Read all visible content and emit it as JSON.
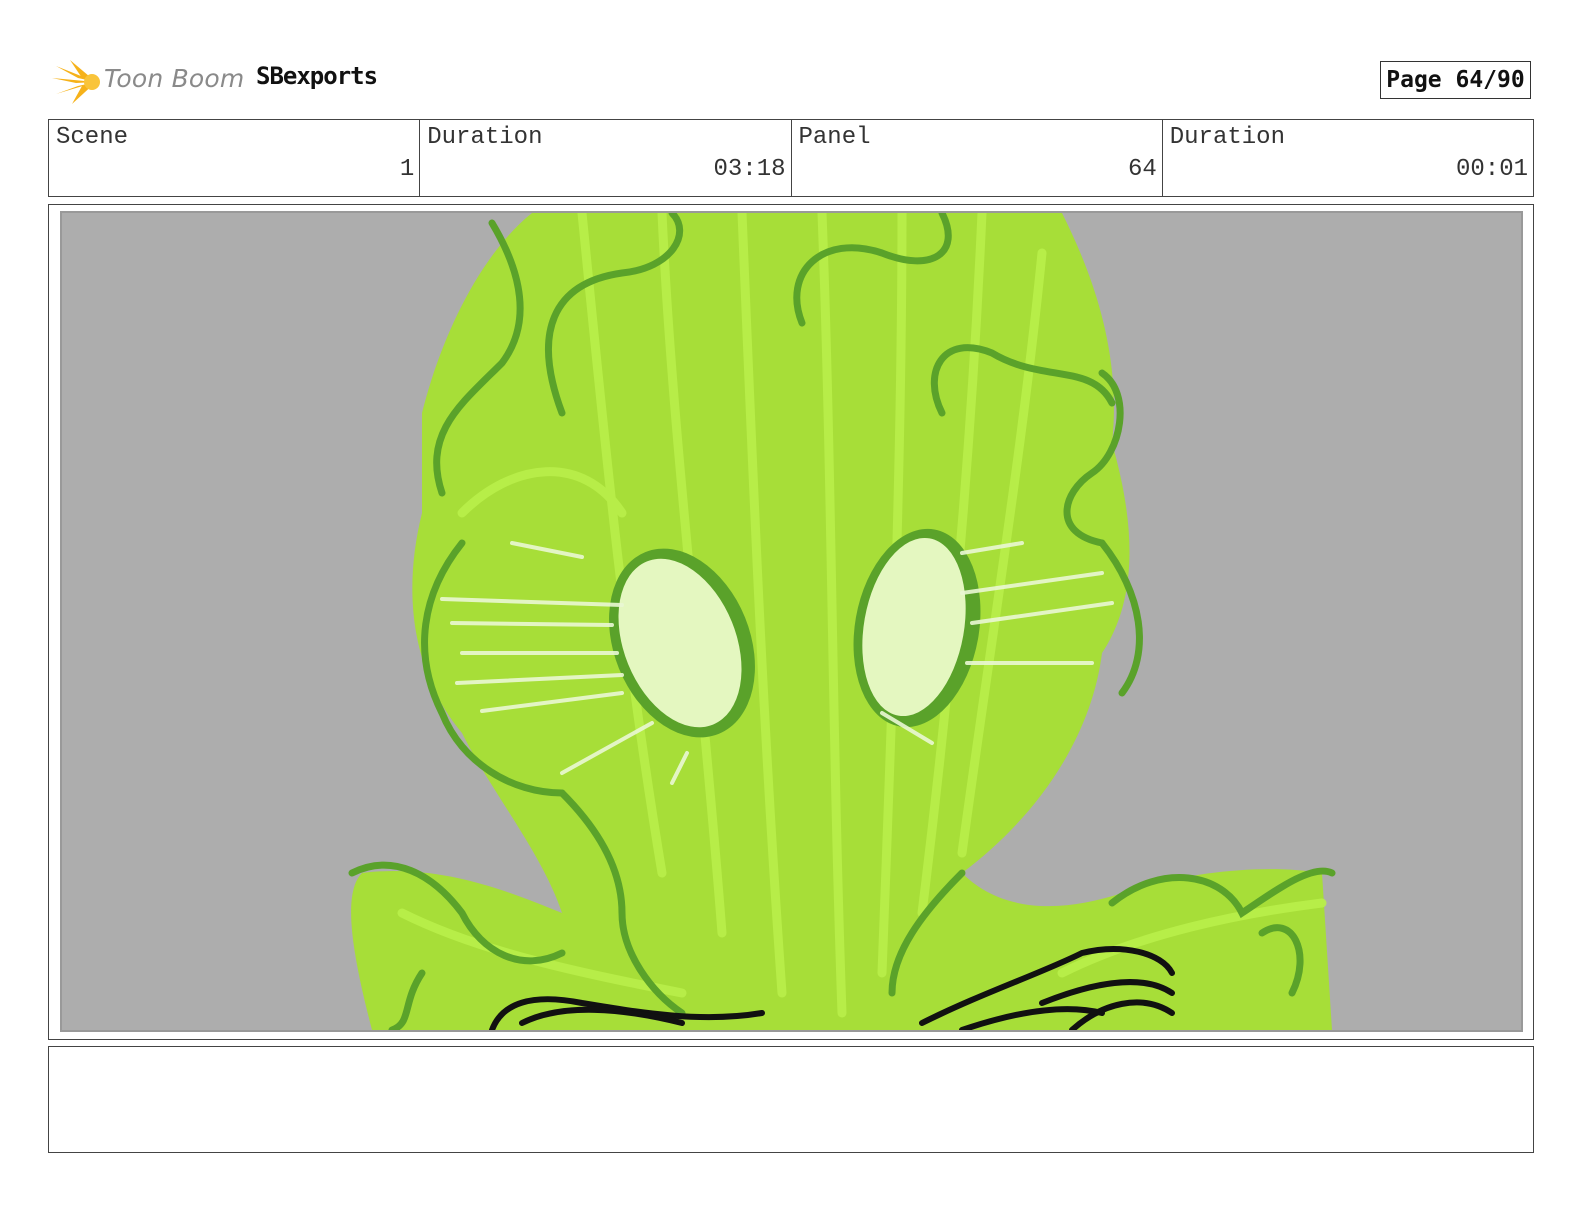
{
  "header": {
    "logo_text": "Toon Boom",
    "project_name": "SBexports",
    "page_label": "Page 64/90"
  },
  "info": {
    "scene_label": "Scene",
    "scene_value": "1",
    "scene_duration_label": "Duration",
    "scene_duration_value": "03:18",
    "panel_label": "Panel",
    "panel_value": "64",
    "panel_duration_label": "Duration",
    "panel_duration_value": "00:01"
  },
  "colors": {
    "logo_star": "#f6b21a",
    "frame_bg": "#adadad",
    "sketch_light_green": "#a6e22e",
    "sketch_dark_green": "#5aa22a",
    "eye_fill": "#e4f7c0"
  },
  "notes": {
    "text": ""
  }
}
